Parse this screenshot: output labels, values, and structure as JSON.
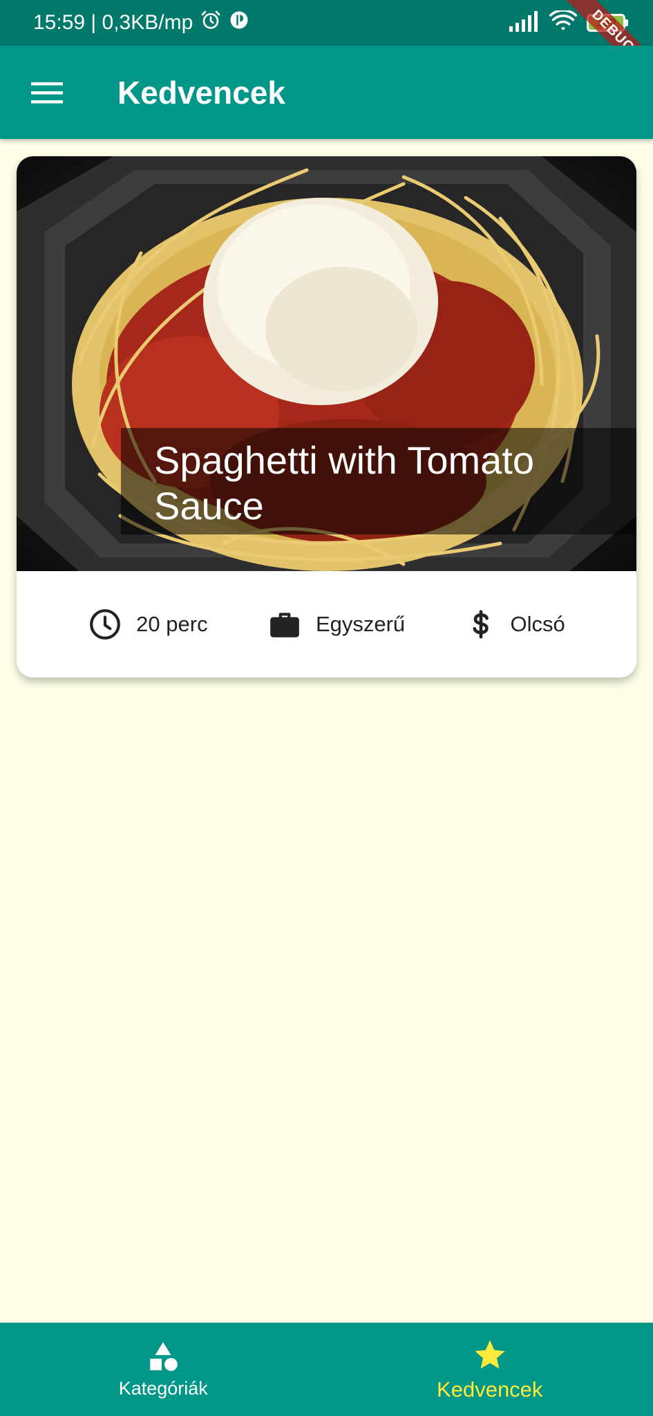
{
  "status_bar": {
    "time_speed": "15:59 | 0,3KB/mp",
    "battery": "100"
  },
  "debug_banner": "DEBUG",
  "app_bar": {
    "menu_icon": "menu-icon",
    "title": "Kedvencek"
  },
  "favorites": [
    {
      "title": "Spaghetti with Tomato Sauce",
      "image": "spaghetti-bolognese-photo",
      "duration": "20 perc",
      "complexity": "Egyszerű",
      "affordability": "Olcsó",
      "icons": {
        "duration": "schedule-icon",
        "complexity": "work-icon",
        "affordability": "dollar-icon"
      }
    }
  ],
  "bottom_nav": {
    "items": [
      {
        "label": "Kategóriák",
        "icon": "category-icon",
        "active": false
      },
      {
        "label": "Kedvencek",
        "icon": "star-icon",
        "active": true
      }
    ],
    "active_color": "#FFEB3B"
  },
  "colors": {
    "primary": "#009688",
    "status_bar": "#00796B",
    "background": "#FEFFE6",
    "accent": "#FFEB3B"
  }
}
